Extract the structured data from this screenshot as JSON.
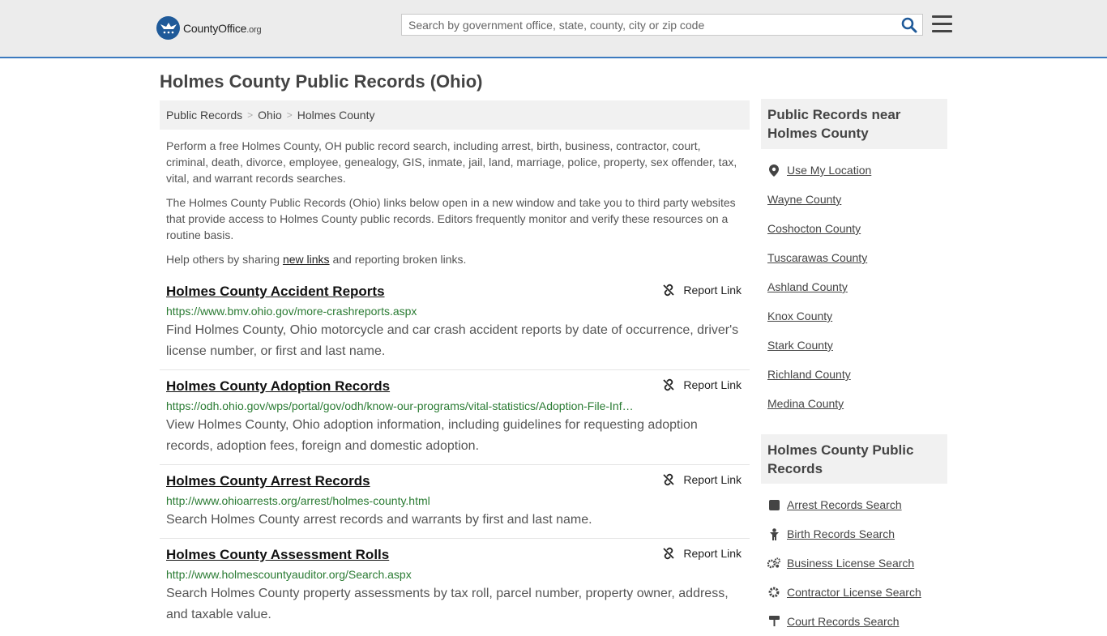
{
  "header": {
    "logo_brand": "CountyOffice",
    "logo_tld": ".org",
    "search_placeholder": "Search by government office, state, county, city or zip code"
  },
  "page_title": "Holmes County Public Records (Ohio)",
  "breadcrumb": [
    "Public Records",
    "Ohio",
    "Holmes County"
  ],
  "intro": {
    "p1": "Perform a free Holmes County, OH public record search, including arrest, birth, business, contractor, court, criminal, death, divorce, employee, genealogy, GIS, inmate, jail, land, marriage, police, property, sex offender, tax, vital, and warrant records searches.",
    "p2": "The Holmes County Public Records (Ohio) links below open in a new window and take you to third party websites that provide access to Holmes County public records. Editors frequently monitor and verify these resources on a routine basis.",
    "p3_before": "Help others by sharing ",
    "p3_link": "new links",
    "p3_after": " and reporting broken links."
  },
  "report_label": "Report Link",
  "records": [
    {
      "title": "Holmes County Accident Reports",
      "url": "https://www.bmv.ohio.gov/more-crashreports.aspx",
      "desc": "Find Holmes County, Ohio motorcycle and car crash accident reports by date of occurrence, driver's license number, or first and last name."
    },
    {
      "title": "Holmes County Adoption Records",
      "url": "https://odh.ohio.gov/wps/portal/gov/odh/know-our-programs/vital-statistics/Adoption-File-Inf…",
      "desc": "View Holmes County, Ohio adoption information, including guidelines for requesting adoption records, adoption fees, foreign and domestic adoption."
    },
    {
      "title": "Holmes County Arrest Records",
      "url": "http://www.ohioarrests.org/arrest/holmes-county.html",
      "desc": "Search Holmes County arrest records and warrants by first and last name."
    },
    {
      "title": "Holmes County Assessment Rolls",
      "url": "http://www.holmescountyauditor.org/Search.aspx",
      "desc": "Search Holmes County property assessments by tax roll, parcel number, property owner, address, and taxable value."
    }
  ],
  "sidebar": {
    "nearby_title": "Public Records near Holmes County",
    "use_location": "Use My Location",
    "nearby": [
      "Wayne County",
      "Coshocton County",
      "Tuscarawas County",
      "Ashland County",
      "Knox County",
      "Stark County",
      "Richland County",
      "Medina County"
    ],
    "records_title": "Holmes County Public Records",
    "record_links": [
      {
        "label": "Arrest Records Search",
        "icon": "arrest-icon"
      },
      {
        "label": "Birth Records Search",
        "icon": "baby-icon"
      },
      {
        "label": "Business License Search",
        "icon": "gears-icon"
      },
      {
        "label": "Contractor License Search",
        "icon": "gear-icon"
      },
      {
        "label": "Court Records Search",
        "icon": "gavel-icon"
      }
    ]
  },
  "colors": {
    "accent": "#3c7abf",
    "url_green": "#2a7b33",
    "logo_blue": "#1f5a99"
  }
}
